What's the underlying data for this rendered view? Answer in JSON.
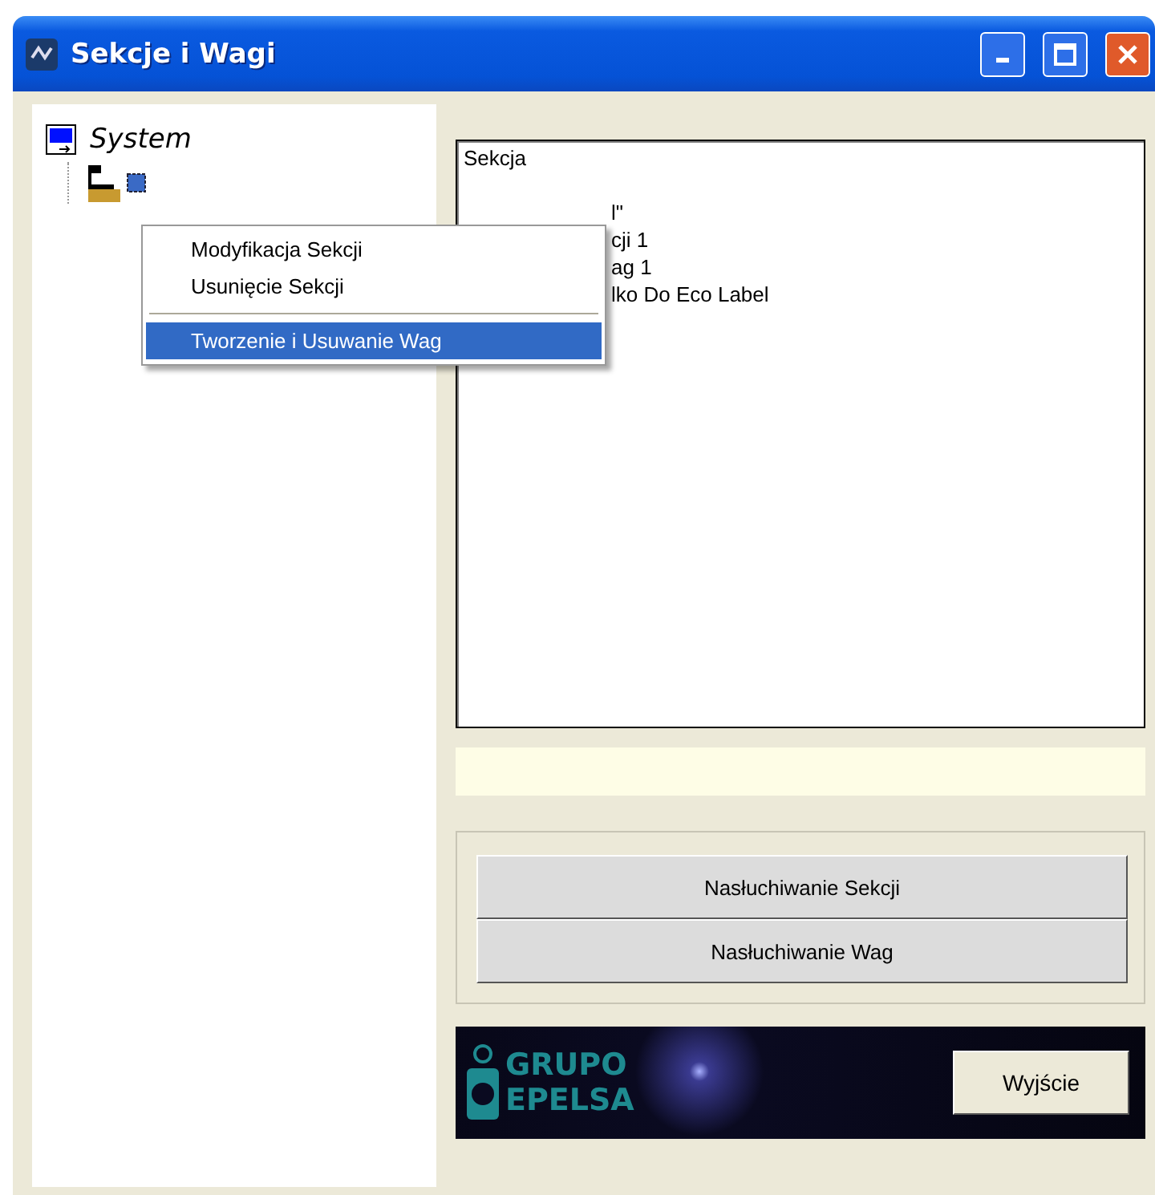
{
  "window": {
    "title": "Sekcje i Wagi"
  },
  "tree": {
    "label": "System",
    "expanded": true
  },
  "context_menu": [
    {
      "kind": "item",
      "label": "Modyfikacja Sekcji",
      "selected": false
    },
    {
      "kind": "item",
      "label": "Usunięcie Sekcji",
      "selected": false
    },
    {
      "kind": "separator"
    },
    {
      "kind": "item",
      "label": "Tworzenie i Usuwanie Wag",
      "selected": true
    }
  ],
  "details": {
    "title": "Sekcja",
    "lines": [
      "l\"",
      "cji 1",
      "ag 1",
      "lko Do Eco Label"
    ]
  },
  "buttons": [
    "Nasłuchiwanie Sekcji",
    "Nasłuchiwanie Wag"
  ],
  "logo": {
    "line_1": "GRUPO",
    "line_2": "EPELSA"
  },
  "exit_button": "Wyjście"
}
